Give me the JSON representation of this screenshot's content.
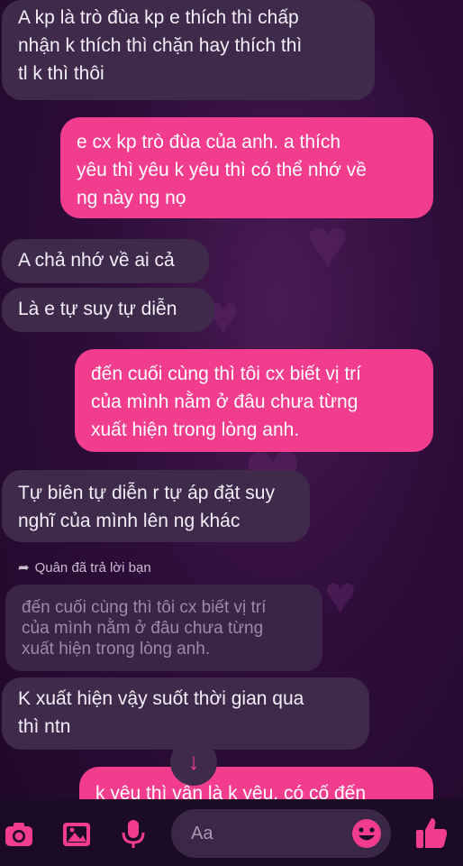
{
  "messages": [
    {
      "side": "received",
      "text": "A kp là trò đùa kp e thích thì chấp\nnhận k thích thì chặn hay thích thì\ntl k thì thôi"
    },
    {
      "side": "sent",
      "text": "e cx kp trò đùa của anh. a thích\nyêu thì yêu k yêu thì có thể nhớ về\nng này ng nọ"
    },
    {
      "side": "received",
      "text": "A chả nhớ về ai cả"
    },
    {
      "side": "received",
      "text": "Là e tự suy tự diễn"
    },
    {
      "side": "sent",
      "text": "đến cuối cùng thì tôi cx biết vị trí\ncủa mình nằm ở đâu chưa từng\nxuất hiện trong lòng anh."
    },
    {
      "side": "received",
      "text": "Tự biên tự diễn r tự áp đặt suy\nnghĩ của mình lên ng khác"
    },
    {
      "side": "received",
      "text": "K xuất hiện vậy suốt thời gian qua\nthì ntn"
    },
    {
      "side": "sent",
      "text": "k yêu thì vẫn là k yêu. có cố đến"
    }
  ],
  "reply": {
    "label": "Quân đã trả lời bạn",
    "quoted_text": "đến cuối cùng thì tôi cx biết vị trí\ncủa mình nằm ở đâu chưa từng\nxuất hiện trong lòng anh."
  },
  "composer": {
    "placeholder": "Aa"
  },
  "icons": [
    "camera-icon",
    "gallery-icon",
    "microphone-icon",
    "emoji-icon",
    "like-icon",
    "reply-arrow-icon",
    "scroll-down-icon"
  ],
  "colors": {
    "accent": "#f23d8f",
    "received_bubble": "#3f2a4c",
    "background": "#2e0d3a"
  }
}
